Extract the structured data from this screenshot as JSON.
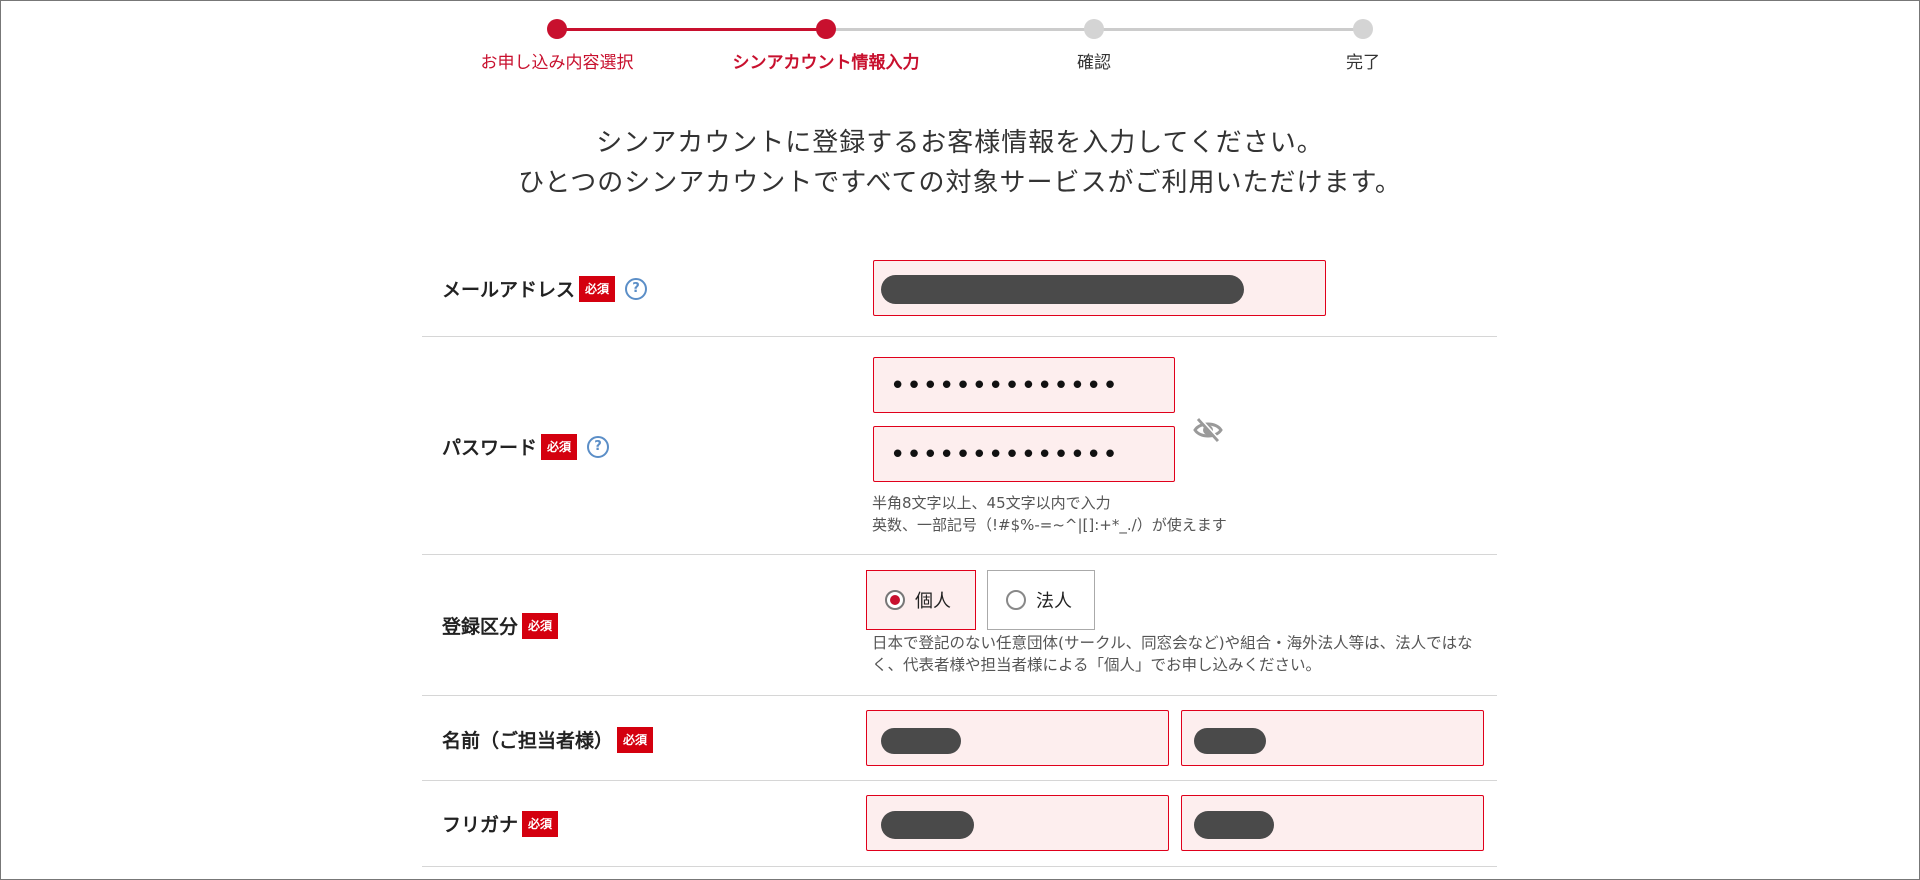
{
  "steps": [
    {
      "label": "お申し込み内容選択",
      "state": "done"
    },
    {
      "label": "シンアカウント情報入力",
      "state": "current"
    },
    {
      "label": "確認",
      "state": "todo"
    },
    {
      "label": "完了",
      "state": "todo"
    }
  ],
  "intro": {
    "line1": "シンアカウントに登録するお客様情報を入力してください。",
    "line2": "ひとつのシンアカウントですべての対象サービスがご利用いただけます。"
  },
  "required_badge": "必須",
  "help_glyph": "?",
  "fields": {
    "email": {
      "label": "メールアドレス"
    },
    "password": {
      "label": "パスワード",
      "value_masked": "••••••••••••••",
      "confirm_masked": "••••••••••••••",
      "hint1": "半角8文字以上、45文字以内で入力",
      "hint2": "英数、一部記号（!#$%-=~^|[]:+*_./）が使えます"
    },
    "registration_type": {
      "label": "登録区分",
      "options": [
        "個人",
        "法人"
      ],
      "selected": "個人",
      "note1": "日本で登記のない任意団体(サークル、同窓会など)や組合・海外法人等は、法人ではな",
      "note2": "く、代表者様や担当者様による「個人」でお申し込みください。"
    },
    "name": {
      "label": "名前（ご担当者様）"
    },
    "furigana": {
      "label": "フリガナ"
    }
  },
  "colors": {
    "accent": "#c8102e",
    "field_bg": "#fdeeee",
    "field_border": "#e0001b"
  }
}
